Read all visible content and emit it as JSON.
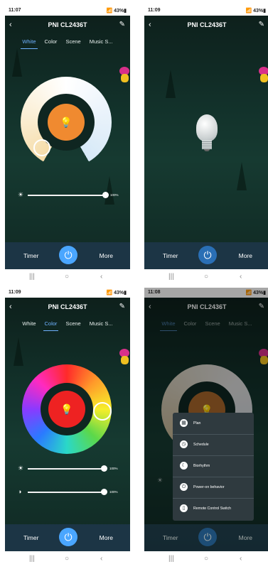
{
  "screens": [
    {
      "status": {
        "time": "11:07",
        "battery": "43%"
      },
      "header": {
        "title": "PNI CL2436T"
      },
      "tabs": [
        "White",
        "Color",
        "Scene",
        "Music S..."
      ],
      "active_tab": "White",
      "brightness_percent": "100%",
      "bottom": {
        "timer": "Timer",
        "more": "More"
      }
    },
    {
      "status": {
        "time": "11:09",
        "battery": "43%"
      },
      "header": {
        "title": "PNI CL2436T"
      },
      "bottom": {
        "timer": "Timer",
        "more": "More"
      }
    },
    {
      "status": {
        "time": "11:09",
        "battery": "43%"
      },
      "header": {
        "title": "PNI CL2436T"
      },
      "tabs": [
        "White",
        "Color",
        "Scene",
        "Music S..."
      ],
      "active_tab": "Color",
      "brightness_percent": "100%",
      "saturation_percent": "100%",
      "bottom": {
        "timer": "Timer",
        "more": "More"
      }
    },
    {
      "status": {
        "time": "11:08",
        "battery": "43%"
      },
      "header": {
        "title": "PNI CL2436T"
      },
      "tabs": [
        "White",
        "Color",
        "Scene",
        "Music S..."
      ],
      "active_tab": "White",
      "menu": [
        "Plan",
        "Schedule",
        "Biorhythm",
        "Power-on behavior",
        "Remote Control Switch"
      ],
      "bottom": {
        "timer": "Timer",
        "more": "More"
      }
    }
  ],
  "icons": {
    "back": "chevron-left-icon",
    "edit": "edit-icon",
    "power": "power-icon",
    "sun": "sun-icon",
    "contrast": "contrast-icon",
    "nav_recent": "recent-apps-icon",
    "nav_home": "home-icon",
    "nav_back": "back-icon"
  },
  "colors": {
    "accent": "#4aa6ff",
    "active_tab": "#6fb2ff",
    "warm_center": "#f08a30",
    "color_center": "#ee2222"
  }
}
